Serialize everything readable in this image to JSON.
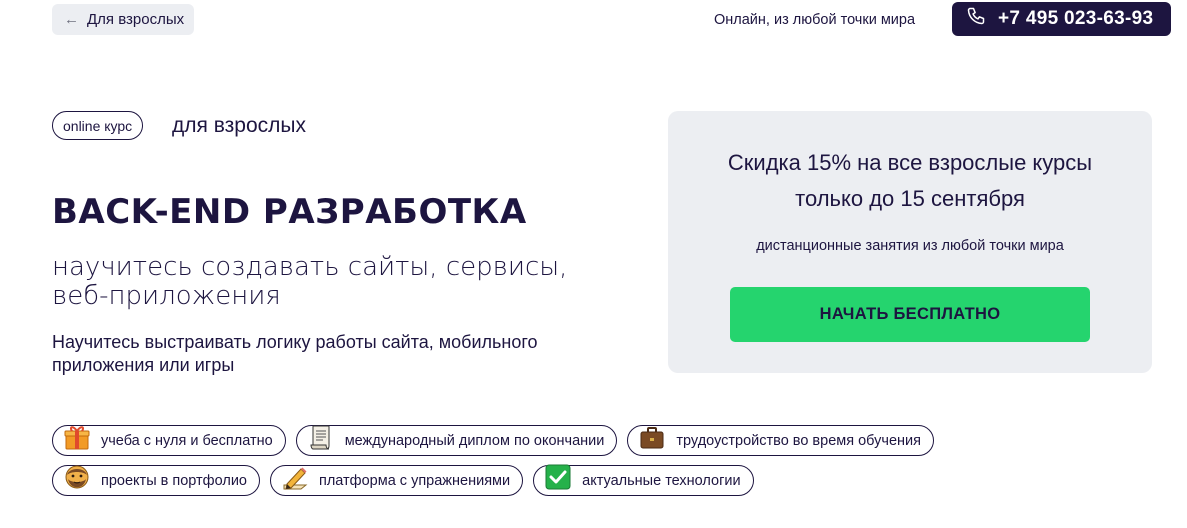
{
  "header": {
    "back_label": "Для взрослых",
    "back_icon": "arrow-left-icon",
    "location_text": "Онлайн, из любой точки мира",
    "phone": "+7 495 023-63-93",
    "phone_icon": "phone-icon"
  },
  "hero": {
    "badge": "online курс",
    "audience": "для взрослых",
    "title": "BACK-END РАЗРАБОТКА",
    "subtitle": "научитесь создавать сайты, сервисы, веб-приложения",
    "description": "Научитесь выстраивать логику работы сайта, мобильного приложения или игры"
  },
  "promo": {
    "title_line1": "Скидка 15% на все взрослые курсы",
    "title_line2": "только до 15 сентября",
    "subtitle": "дистанционные занятия из любой точки мира",
    "cta_label": "НАЧАТЬ БЕСПЛАТНО"
  },
  "features": [
    {
      "label": "учеба с нуля и бесплатно",
      "icon": "gift-icon"
    },
    {
      "label": "международный диплом по окончании",
      "icon": "scroll-icon"
    },
    {
      "label": "трудоустройство во время обучения",
      "icon": "briefcase-icon"
    },
    {
      "label": "проекты в портфолио",
      "icon": "bearded-face-icon"
    },
    {
      "label": "платформа с упражнениями",
      "icon": "pencil-icon"
    },
    {
      "label": "актуальные технологии",
      "icon": "checkmark-icon"
    }
  ],
  "colors": {
    "primary_dark": "#1d1540",
    "accent_green": "#25d46e",
    "card_bg": "#eceef2"
  }
}
